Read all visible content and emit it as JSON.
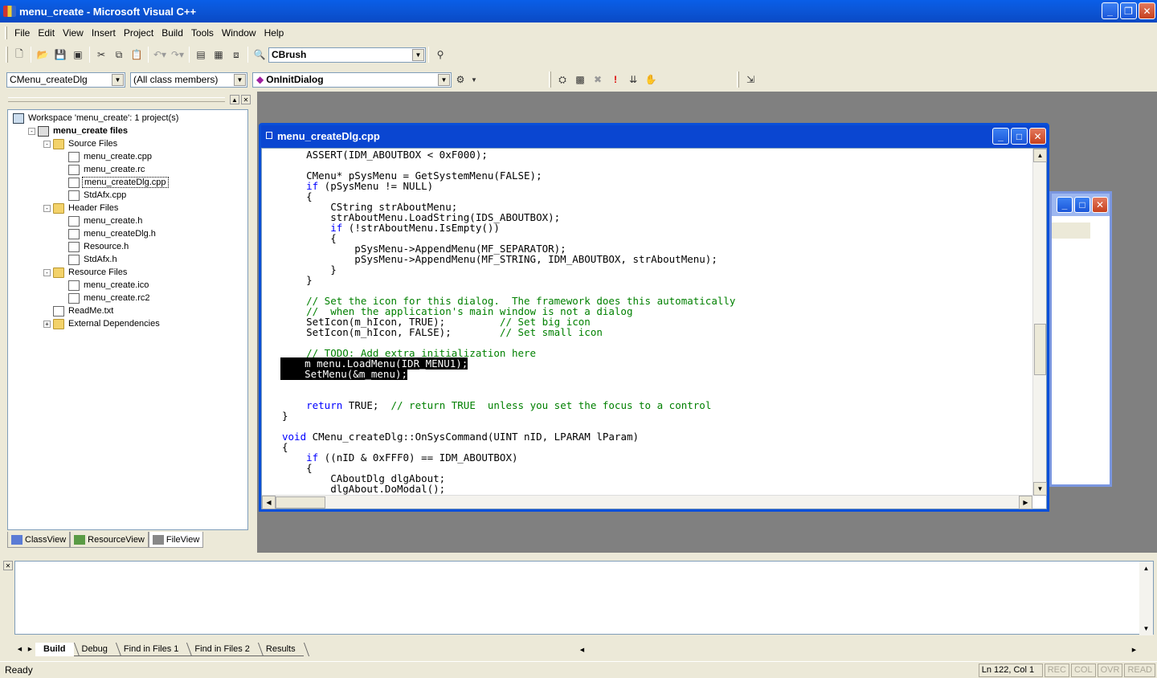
{
  "window": {
    "title": "menu_create - Microsoft Visual C++"
  },
  "menubar": [
    "File",
    "Edit",
    "View",
    "Insert",
    "Project",
    "Build",
    "Tools",
    "Window",
    "Help"
  ],
  "toolbar": {
    "find_combo": "CBrush",
    "class_combo": "CMenu_createDlg",
    "filter_combo": "(All class members)",
    "member_combo": "OnInitDialog"
  },
  "workspace": {
    "tree": [
      {
        "indent": 0,
        "exp": "",
        "icon": "ws",
        "label": "Workspace 'menu_create': 1 project(s)",
        "bold": false,
        "sel": false
      },
      {
        "indent": 1,
        "exp": "-",
        "icon": "proj",
        "label": "menu_create files",
        "bold": true,
        "sel": false
      },
      {
        "indent": 2,
        "exp": "-",
        "icon": "folder",
        "label": "Source Files",
        "bold": false,
        "sel": false
      },
      {
        "indent": 3,
        "exp": "",
        "icon": "file",
        "label": "menu_create.cpp",
        "bold": false,
        "sel": false
      },
      {
        "indent": 3,
        "exp": "",
        "icon": "file",
        "label": "menu_create.rc",
        "bold": false,
        "sel": false
      },
      {
        "indent": 3,
        "exp": "",
        "icon": "file",
        "label": "menu_createDlg.cpp",
        "bold": false,
        "sel": true
      },
      {
        "indent": 3,
        "exp": "",
        "icon": "file",
        "label": "StdAfx.cpp",
        "bold": false,
        "sel": false
      },
      {
        "indent": 2,
        "exp": "-",
        "icon": "folder",
        "label": "Header Files",
        "bold": false,
        "sel": false
      },
      {
        "indent": 3,
        "exp": "",
        "icon": "file",
        "label": "menu_create.h",
        "bold": false,
        "sel": false
      },
      {
        "indent": 3,
        "exp": "",
        "icon": "file",
        "label": "menu_createDlg.h",
        "bold": false,
        "sel": false
      },
      {
        "indent": 3,
        "exp": "",
        "icon": "file",
        "label": "Resource.h",
        "bold": false,
        "sel": false
      },
      {
        "indent": 3,
        "exp": "",
        "icon": "file",
        "label": "StdAfx.h",
        "bold": false,
        "sel": false
      },
      {
        "indent": 2,
        "exp": "-",
        "icon": "folder",
        "label": "Resource Files",
        "bold": false,
        "sel": false
      },
      {
        "indent": 3,
        "exp": "",
        "icon": "file",
        "label": "menu_create.ico",
        "bold": false,
        "sel": false
      },
      {
        "indent": 3,
        "exp": "",
        "icon": "file",
        "label": "menu_create.rc2",
        "bold": false,
        "sel": false
      },
      {
        "indent": 2,
        "exp": "",
        "icon": "file",
        "label": "ReadMe.txt",
        "bold": false,
        "sel": false
      },
      {
        "indent": 2,
        "exp": "+",
        "icon": "folder",
        "label": "External Dependencies",
        "bold": false,
        "sel": false
      }
    ],
    "tabs": [
      "ClassView",
      "ResourceView",
      "FileView"
    ],
    "active_tab": 2
  },
  "editor": {
    "title": "menu_createDlg.cpp",
    "lines": [
      [
        [
          "n",
          "    ASSERT(IDM_ABOUTBOX < 0xF000);"
        ]
      ],
      [
        [
          "n",
          ""
        ]
      ],
      [
        [
          "n",
          "    CMenu* pSysMenu = GetSystemMenu(FALSE);"
        ]
      ],
      [
        [
          "k",
          "    if"
        ],
        [
          "n",
          " (pSysMenu != NULL)"
        ]
      ],
      [
        [
          "n",
          "    {"
        ]
      ],
      [
        [
          "n",
          "        CString strAboutMenu;"
        ]
      ],
      [
        [
          "n",
          "        strAboutMenu.LoadString(IDS_ABOUTBOX);"
        ]
      ],
      [
        [
          "k",
          "        if"
        ],
        [
          "n",
          " (!strAboutMenu.IsEmpty())"
        ]
      ],
      [
        [
          "n",
          "        {"
        ]
      ],
      [
        [
          "n",
          "            pSysMenu->AppendMenu(MF_SEPARATOR);"
        ]
      ],
      [
        [
          "n",
          "            pSysMenu->AppendMenu(MF_STRING, IDM_ABOUTBOX, strAboutMenu);"
        ]
      ],
      [
        [
          "n",
          "        }"
        ]
      ],
      [
        [
          "n",
          "    }"
        ]
      ],
      [
        [
          "n",
          ""
        ]
      ],
      [
        [
          "c",
          "    // Set the icon for this dialog.  The framework does this automatically"
        ]
      ],
      [
        [
          "c",
          "    //  when the application's main window is not a dialog"
        ]
      ],
      [
        [
          "n",
          "    SetIcon(m_hIcon, TRUE);         "
        ],
        [
          "c",
          "// Set big icon"
        ]
      ],
      [
        [
          "n",
          "    SetIcon(m_hIcon, FALSE);        "
        ],
        [
          "c",
          "// Set small icon"
        ]
      ],
      [
        [
          "n",
          ""
        ]
      ],
      [
        [
          "c",
          "    // TODO: Add extra initialization here"
        ]
      ],
      [
        [
          "s",
          "    m_menu.LoadMenu(IDR_MENU1);"
        ]
      ],
      [
        [
          "s",
          "    SetMenu(&m_menu);"
        ]
      ],
      [
        [
          "n",
          ""
        ]
      ],
      [
        [
          "n",
          ""
        ]
      ],
      [
        [
          "k",
          "    return"
        ],
        [
          "n",
          " TRUE;  "
        ],
        [
          "c",
          "// return TRUE  unless you set the focus to a control"
        ]
      ],
      [
        [
          "n",
          "}"
        ]
      ],
      [
        [
          "n",
          ""
        ]
      ],
      [
        [
          "k",
          "void"
        ],
        [
          "n",
          " CMenu_createDlg::OnSysCommand(UINT nID, LPARAM lParam)"
        ]
      ],
      [
        [
          "n",
          "{"
        ]
      ],
      [
        [
          "k",
          "    if"
        ],
        [
          "n",
          " ((nID & 0xFFF0) == IDM_ABOUTBOX)"
        ]
      ],
      [
        [
          "n",
          "    {"
        ]
      ],
      [
        [
          "n",
          "        CAboutDlg dlgAbout;"
        ]
      ],
      [
        [
          "n",
          "        dlgAbout.DoModal();"
        ]
      ],
      [
        [
          "n",
          "    }"
        ]
      ]
    ]
  },
  "output": {
    "tabs": [
      "Build",
      "Debug",
      "Find in Files 1",
      "Find in Files 2",
      "Results"
    ],
    "active_tab": 0
  },
  "status": {
    "message": "Ready",
    "position": "Ln 122, Col 1",
    "indicators": [
      "REC",
      "COL",
      "OVR",
      "READ"
    ]
  }
}
